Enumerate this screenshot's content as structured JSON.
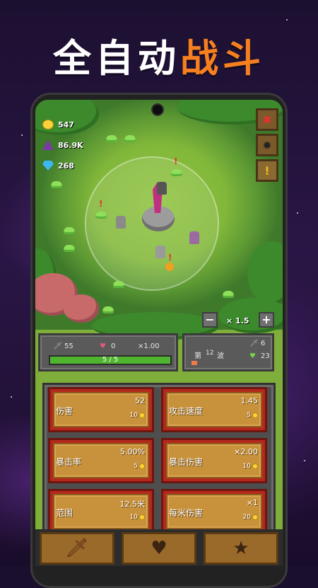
{
  "headline": {
    "part1": "全自动",
    "part2": "战斗"
  },
  "resources": {
    "gold": "547",
    "mana": "86.9K",
    "gems": "268"
  },
  "side_buttons": {
    "close": "✖",
    "settings": "✹",
    "alert": "!"
  },
  "zoom": {
    "minus": "−",
    "plus": "+",
    "level": "× 1.5"
  },
  "hero_stats": {
    "attack": "55",
    "hearts": "0",
    "multiplier": "×1.00",
    "progress_text": "5 / 5",
    "progress": 1.0
  },
  "wave": {
    "prefix": "第",
    "number": "12",
    "suffix": "波",
    "swords": "6",
    "hearts": "23"
  },
  "upgrades": [
    {
      "name": "伤害",
      "value": "52",
      "cost": "10"
    },
    {
      "name": "攻击速度",
      "value": "1.45",
      "cost": "5"
    },
    {
      "name": "暴击率",
      "value": "5.00%",
      "cost": "5"
    },
    {
      "name": "暴击伤害",
      "value": "×2.00",
      "cost": "10"
    },
    {
      "name": "范围",
      "value": "12.5米",
      "cost": "10"
    },
    {
      "name": "每米伤害",
      "value": "×1",
      "cost": "20"
    }
  ],
  "tabs": [
    {
      "icon": "sword-icon",
      "glyph": "🗡"
    },
    {
      "icon": "heart-icon",
      "glyph": "♥"
    },
    {
      "icon": "star-icon",
      "glyph": "★"
    }
  ],
  "colors": {
    "accent": "#f6801f",
    "grass": "#82b83a",
    "card": "#c8923c",
    "progress": "#4fb52f"
  }
}
